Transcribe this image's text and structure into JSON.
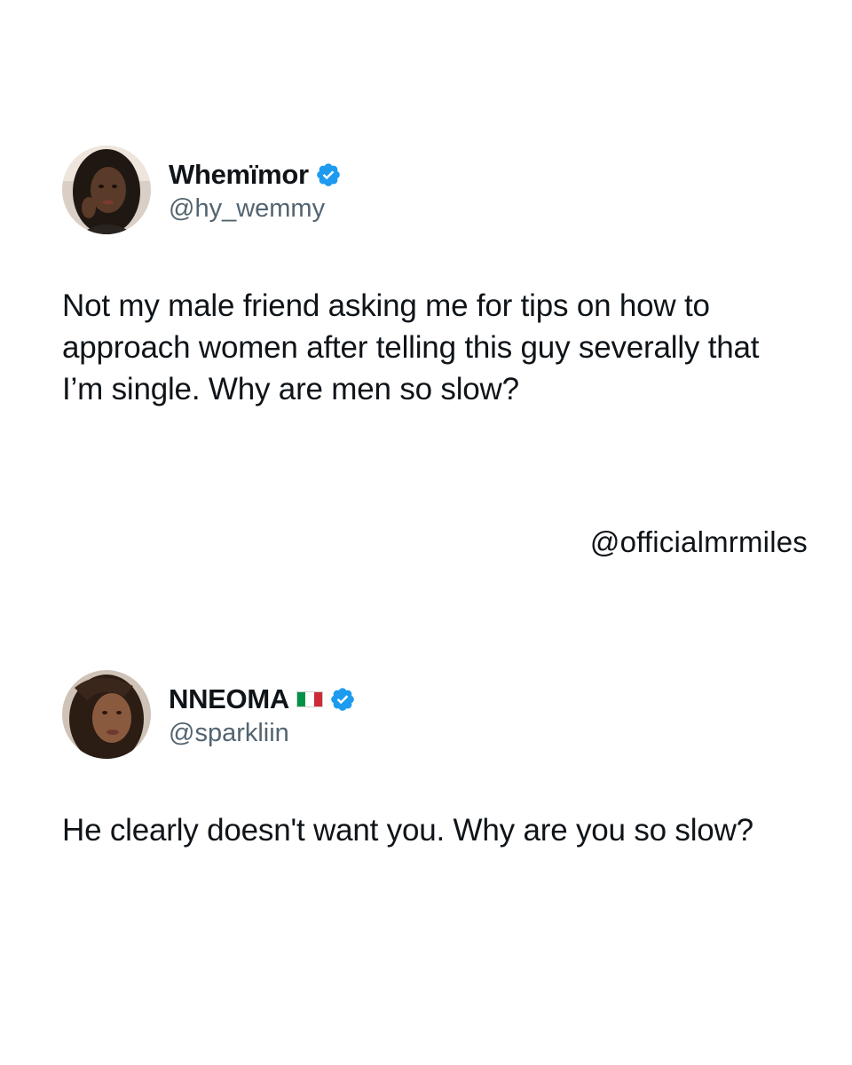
{
  "tweets": [
    {
      "display_name": "Whemïmor",
      "handle": "@hy_wemmy",
      "verified": true,
      "avatar_icon": "avatar-photo",
      "text": "Not my male friend asking me for tips on how to approach women after telling this guy severally that I’m single. Why are men so slow?"
    },
    {
      "display_name": "NNEOMA",
      "flag_icon": "italy-flag",
      "flag_colors": [
        "#009246",
        "#ffffff",
        "#ce2b37"
      ],
      "handle": "@sparkliin",
      "verified": true,
      "avatar_icon": "avatar-photo",
      "text": "He clearly doesn't want you. Why are you so slow?"
    }
  ],
  "watermark": "@officialmrmiles",
  "colors": {
    "verified_blue": "#1d9bf0",
    "handle_gray": "#536471",
    "text": "#0f1419",
    "background": "#ffffff"
  }
}
